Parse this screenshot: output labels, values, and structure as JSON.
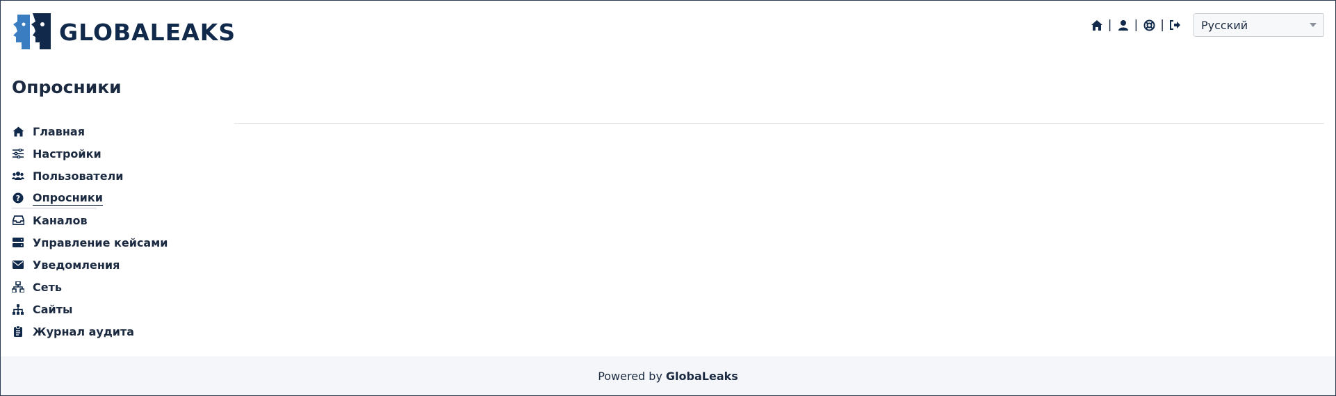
{
  "header": {
    "logo_text": "GLOBALEAKS",
    "top_icons": [
      "home-icon",
      "user-icon",
      "lifebuoy-icon",
      "logout-icon"
    ],
    "separator": "|",
    "language": {
      "selected": "Русский"
    }
  },
  "page": {
    "title": "Опросники"
  },
  "sidebar": {
    "items": [
      {
        "label": "Главная",
        "icon": "home-icon"
      },
      {
        "label": "Настройки",
        "icon": "sliders-icon"
      },
      {
        "label": "Пользователи",
        "icon": "users-icon"
      },
      {
        "label": "Опросники",
        "icon": "question-circle-icon",
        "active": true
      },
      {
        "label": "Каналов",
        "icon": "inbox-icon"
      },
      {
        "label": "Управление кейсами",
        "icon": "server-icon"
      },
      {
        "label": "Уведомления",
        "icon": "envelope-icon"
      },
      {
        "label": "Сеть",
        "icon": "network-icon"
      },
      {
        "label": "Сайты",
        "icon": "sitemap-icon"
      },
      {
        "label": "Журнал аудита",
        "icon": "clipboard-icon"
      }
    ]
  },
  "footer": {
    "powered_by": "Powered by",
    "brand": "GlobaLeaks"
  },
  "colors": {
    "brand_dark": "#11294a",
    "brand_blue": "#3a7dc1",
    "footer_bg": "#f4f6f9"
  }
}
